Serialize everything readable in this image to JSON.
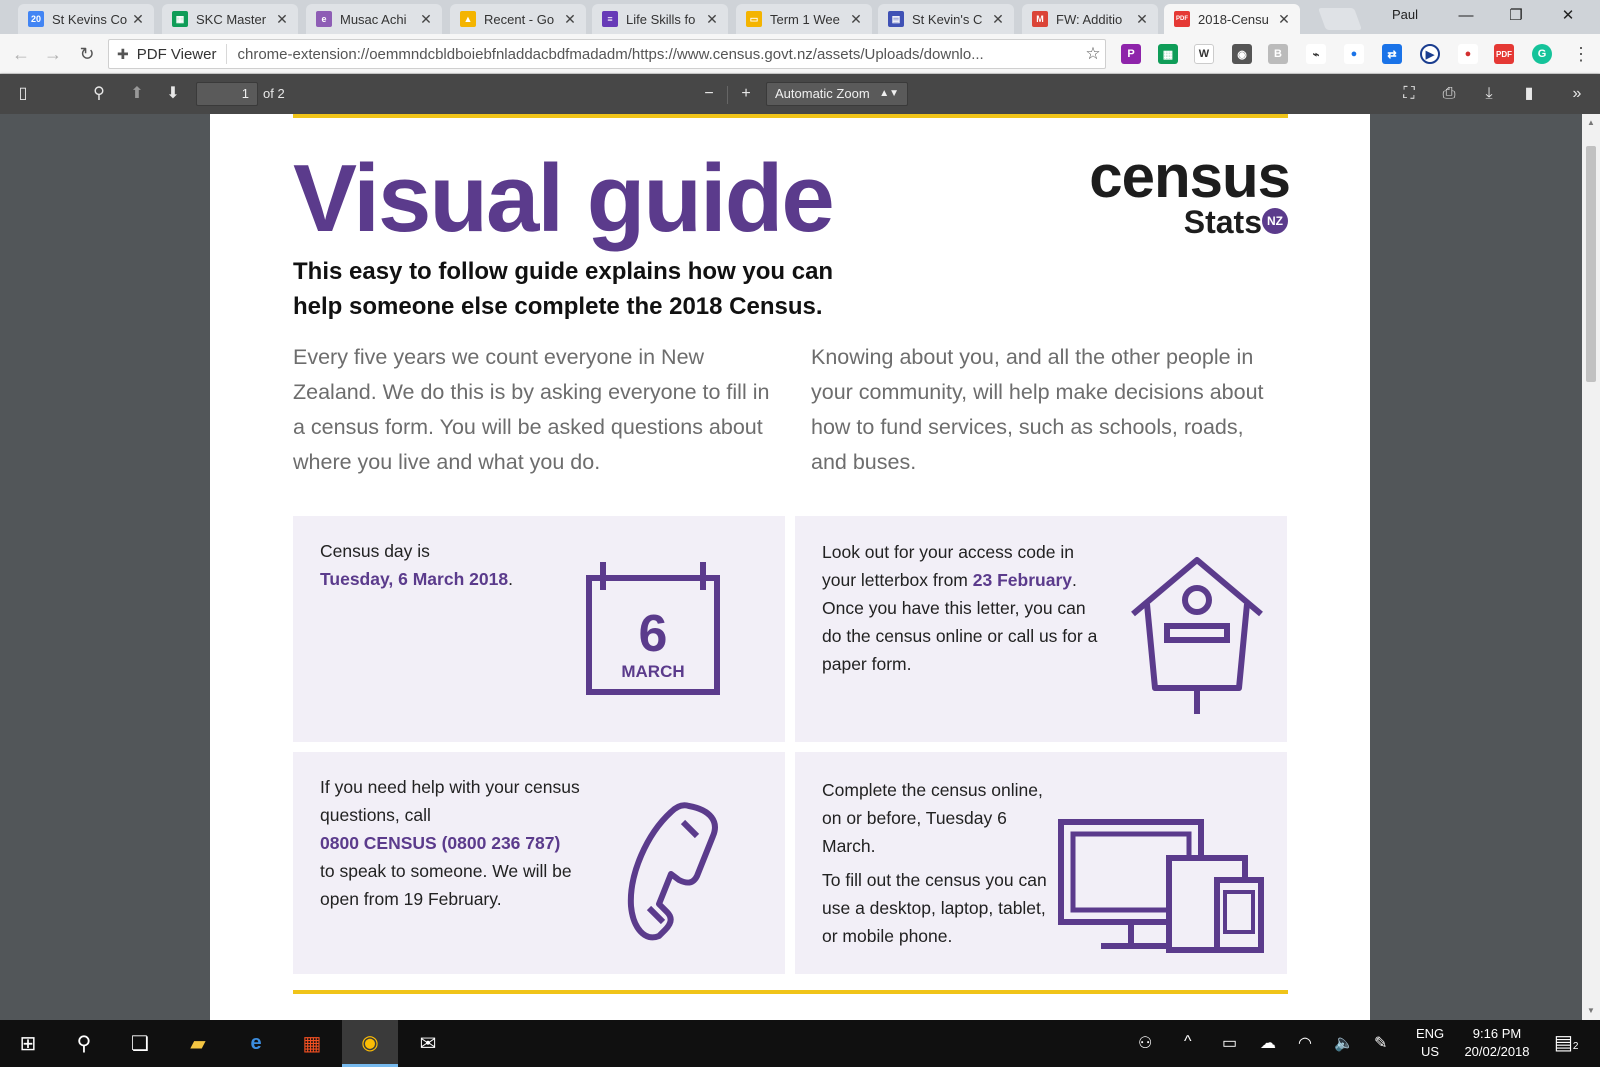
{
  "browser": {
    "tabs": [
      {
        "title": "St Kevins Co",
        "icon": "calendar-icon",
        "color": "#4285f4",
        "glyph": "20"
      },
      {
        "title": "SKC Master",
        "icon": "sheets-icon",
        "color": "#0f9d58",
        "glyph": "▦"
      },
      {
        "title": "Musac Achi",
        "icon": "musac-icon",
        "color": "#8e5db5",
        "glyph": "e"
      },
      {
        "title": "Recent - Go",
        "icon": "drive-icon",
        "color": "#f4b400",
        "glyph": "▲"
      },
      {
        "title": "Life Skills fo",
        "icon": "forms-icon",
        "color": "#673ab7",
        "glyph": "≡"
      },
      {
        "title": "Term 1 Wee",
        "icon": "slides-icon",
        "color": "#f4b400",
        "glyph": "▭"
      },
      {
        "title": "St Kevin's C",
        "icon": "sites-icon",
        "color": "#3f51b5",
        "glyph": "▤"
      },
      {
        "title": "FW: Additio",
        "icon": "gmail-icon",
        "color": "#db4437",
        "glyph": "M"
      },
      {
        "title": "2018-Censu",
        "icon": "pdf-icon",
        "color": "#e53935",
        "glyph": "PDF"
      }
    ],
    "profile": "Paul",
    "address": {
      "label": "PDF Viewer",
      "url": "chrome-extension://oemmndcbldboiebfnladdacbdfmadadm/https://www.census.govt.nz/assets/Uploads/downlo..."
    }
  },
  "pdf_toolbar": {
    "page_number": "1",
    "page_count": "of 2",
    "zoom": "Automatic Zoom"
  },
  "document": {
    "title": "Visual guide",
    "logo": {
      "word": "census",
      "sub": "Stats",
      "badge": "NZ"
    },
    "lead": "This easy to follow guide explains how you can help someone else complete the 2018 Census.",
    "para_left": "Every five years we count everyone in New Zealand. We do this is by asking everyone to fill in a census form. You will be asked questions about where you live and what you do.",
    "para_right": "Knowing about you, and all the other people in your community, will help make decisions about how to fund services, such as schools, roads, and buses.",
    "cards": {
      "census_day": {
        "text": "Census day is",
        "highlight": "Tuesday, 6 March 2018",
        "suffix": ".",
        "calendar_day": "6",
        "calendar_month": "MARCH"
      },
      "access_code": {
        "pre": "Look out for your access code in your letterbox from",
        "highlight": "23 February",
        "post": ". Once you have this letter, you can do the census online or call us for a paper form."
      },
      "help": {
        "pre": "If you need help with your census questions, call",
        "highlight": "0800 CENSUS (0800 236 787)",
        "post": "to speak to someone. We will be open from 19 February."
      },
      "online": {
        "line1": "Complete the census online, on or before, Tuesday 6 March.",
        "line2": "To fill out the census you can use a desktop, laptop, tablet, or mobile phone."
      }
    },
    "accent_color": "#5b3b8c",
    "rule_color": "#f0c419",
    "card_bg": "#f2eff7"
  },
  "taskbar": {
    "lang_top": "ENG",
    "lang_bottom": "US",
    "time": "9:16 PM",
    "date": "20/02/2018",
    "notifications": "2"
  }
}
